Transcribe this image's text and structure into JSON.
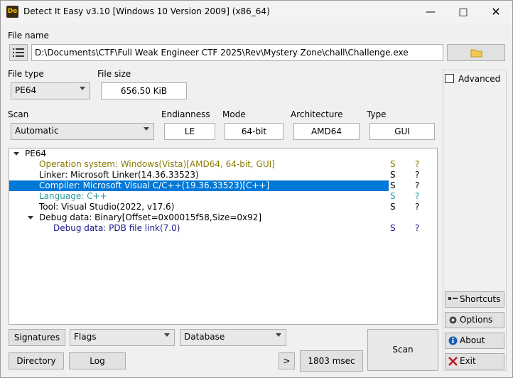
{
  "window": {
    "title": "Detect It Easy v3.10 [Windows 10 Version 2009] (x86_64)",
    "icon_text": "De"
  },
  "file": {
    "label": "File name",
    "path": "D:\\Documents\\CTF\\Full Weak Engineer CTF 2025\\Rev\\Mystery Zone\\chall\\Challenge.exe"
  },
  "filetype": {
    "label": "File type",
    "value": "PE64"
  },
  "filesize": {
    "label": "File size",
    "value": "656.50 KiB"
  },
  "scan": {
    "label": "Scan",
    "value": "Automatic"
  },
  "endianness": {
    "label": "Endianness",
    "value": "LE"
  },
  "mode": {
    "label": "Mode",
    "value": "64-bit"
  },
  "architecture": {
    "label": "Architecture",
    "value": "AMD64"
  },
  "type": {
    "label": "Type",
    "value": "GUI"
  },
  "advanced": {
    "label": "Advanced",
    "checked": false
  },
  "tree": {
    "root": "PE64",
    "rows": [
      {
        "text": "Operation system: Windows(Vista)[AMD64, 64-bit, GUI]",
        "s": "S",
        "q": "?",
        "color": "#8a7a00"
      },
      {
        "text": "Linker: Microsoft Linker(14.36.33523)",
        "s": "S",
        "q": "?",
        "color": "#000000"
      },
      {
        "text": "Compiler: Microsoft Visual C/C++(19.36.33523)[C++]",
        "s": "S",
        "q": "?",
        "color": "#ffffff",
        "selected": true
      },
      {
        "text": "Language: C++",
        "s": "S",
        "q": "?",
        "color": "#2a9a9a"
      },
      {
        "text": "Tool: Visual Studio(2022, v17.6)",
        "s": "S",
        "q": "?",
        "color": "#000000"
      },
      {
        "text": "Debug data: Binary[Offset=0x00015f58,Size=0x92]",
        "s": "",
        "q": "",
        "color": "#000000"
      },
      {
        "text": "Debug data: PDB file link(7.0)",
        "s": "S",
        "q": "?",
        "color": "#1a1a8a"
      }
    ]
  },
  "bottom": {
    "signatures": "Signatures",
    "flags": "Flags",
    "database": "Database",
    "directory": "Directory",
    "log": "Log",
    "more": ">",
    "time": "1803 msec",
    "scan": "Scan"
  },
  "side": {
    "shortcuts": "Shortcuts",
    "options": "Options",
    "about": "About",
    "exit": "Exit"
  }
}
